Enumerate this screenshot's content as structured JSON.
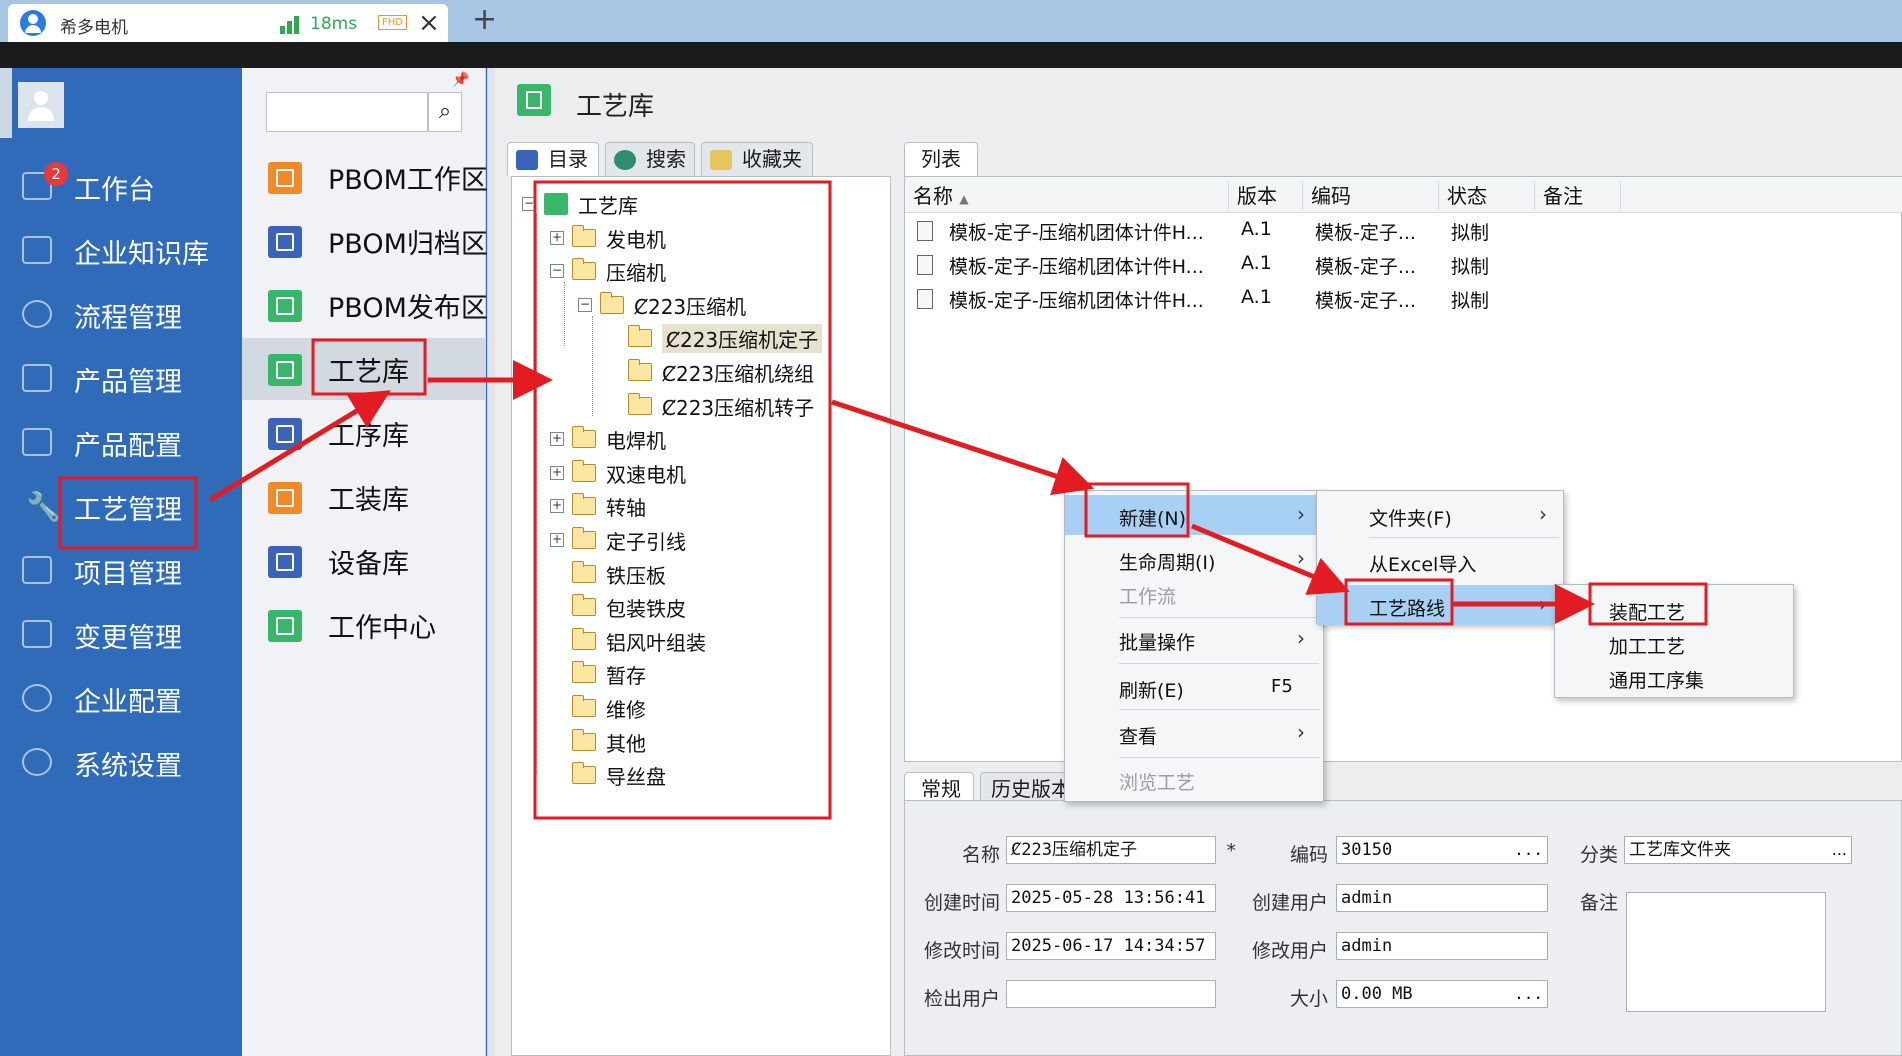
{
  "browser_tab": {
    "title": "希多电机",
    "latency": "18ms",
    "quality": "FHD"
  },
  "left_nav": {
    "badge": "2",
    "items": [
      {
        "label": "工作台"
      },
      {
        "label": "企业知识库"
      },
      {
        "label": "流程管理"
      },
      {
        "label": "产品管理"
      },
      {
        "label": "产品配置"
      },
      {
        "label": "工艺管理"
      },
      {
        "label": "项目管理"
      },
      {
        "label": "变更管理"
      },
      {
        "label": "企业配置"
      },
      {
        "label": "系统设置"
      }
    ]
  },
  "sub_nav": {
    "search_placeholder": "",
    "items": [
      {
        "label": "PBOM工作区",
        "color": "#f08a2a"
      },
      {
        "label": "PBOM归档区",
        "color": "#3a64b8"
      },
      {
        "label": "PBOM发布区",
        "color": "#3ab66a"
      },
      {
        "label": "工艺库",
        "color": "#3ab66a"
      },
      {
        "label": "工序库",
        "color": "#3a64b8"
      },
      {
        "label": "工装库",
        "color": "#f08a2a"
      },
      {
        "label": "设备库",
        "color": "#3a64b8"
      },
      {
        "label": "工作中心",
        "color": "#3ab66a"
      }
    ]
  },
  "main": {
    "title": "工艺库",
    "tree_tabs": [
      "目录",
      "搜索",
      "收藏夹"
    ],
    "list_tab": "列表",
    "tree": [
      {
        "label": "工艺库"
      },
      {
        "label": "发电机"
      },
      {
        "label": "压缩机"
      },
      {
        "label": "Ȼ223压缩机"
      },
      {
        "label": "Ȼ223压缩机定子"
      },
      {
        "label": "Ȼ223压缩机绕组"
      },
      {
        "label": "Ȼ223压缩机转子"
      },
      {
        "label": "电焊机"
      },
      {
        "label": "双速电机"
      },
      {
        "label": "转轴"
      },
      {
        "label": "定子引线"
      },
      {
        "label": "铁压板"
      },
      {
        "label": "包装铁皮"
      },
      {
        "label": "铝风叶组装"
      },
      {
        "label": "暂存"
      },
      {
        "label": "维修"
      },
      {
        "label": "其他"
      },
      {
        "label": "导丝盘"
      }
    ],
    "list": {
      "columns": [
        "名称",
        "版本",
        "编码",
        "状态",
        "备注"
      ],
      "rows": [
        {
          "name": "模板-定子-压缩机团体计件H...",
          "version": "A.1",
          "code": "模板-定子...",
          "status": "拟制"
        },
        {
          "name": "模板-定子-压缩机团体计件H...",
          "version": "A.1",
          "code": "模板-定子...",
          "status": "拟制"
        },
        {
          "name": "模板-定子-压缩机团体计件H...",
          "version": "A.1",
          "code": "模板-定子...",
          "status": "拟制"
        }
      ]
    },
    "detail_tabs": [
      "常规",
      "历史版本"
    ],
    "detail": {
      "name_label": "名称",
      "name_value": "Ȼ223压缩机定子",
      "required_mark": "*",
      "code_label": "编码",
      "code_value": "30150",
      "category_label": "分类",
      "category_value": "工艺库文件夹",
      "remark_label": "备注",
      "created_time_label": "创建时间",
      "created_time_value": "2025-05-28 13:56:41",
      "created_user_label": "创建用户",
      "created_user_value": "admin",
      "modified_time_label": "修改时间",
      "modified_time_value": "2025-06-17 14:34:57",
      "modified_user_label": "修改用户",
      "modified_user_value": "admin",
      "checkout_user_label": "检出用户",
      "checkout_user_value": "",
      "size_label": "大小",
      "size_value": "0.00 MB",
      "ellipsis": "..."
    }
  },
  "context_menu": {
    "items": [
      {
        "label": "新建(N)",
        "shortcut": ""
      },
      {
        "label": "生命周期(I)",
        "shortcut": ""
      },
      {
        "label": "工作流",
        "shortcut": ""
      },
      {
        "label": "批量操作",
        "shortcut": ""
      },
      {
        "label": "刷新(E)",
        "shortcut": "F5"
      },
      {
        "label": "查看",
        "shortcut": ""
      },
      {
        "label": "浏览工艺",
        "shortcut": ""
      }
    ],
    "submenu_new": [
      {
        "label": "文件夹(F)"
      },
      {
        "label": "从Excel导入"
      },
      {
        "label": "工艺路线"
      }
    ],
    "submenu_route": [
      {
        "label": "装配工艺"
      },
      {
        "label": "加工工艺"
      },
      {
        "label": "通用工序集"
      }
    ]
  },
  "annotation_color": "#e31b23"
}
